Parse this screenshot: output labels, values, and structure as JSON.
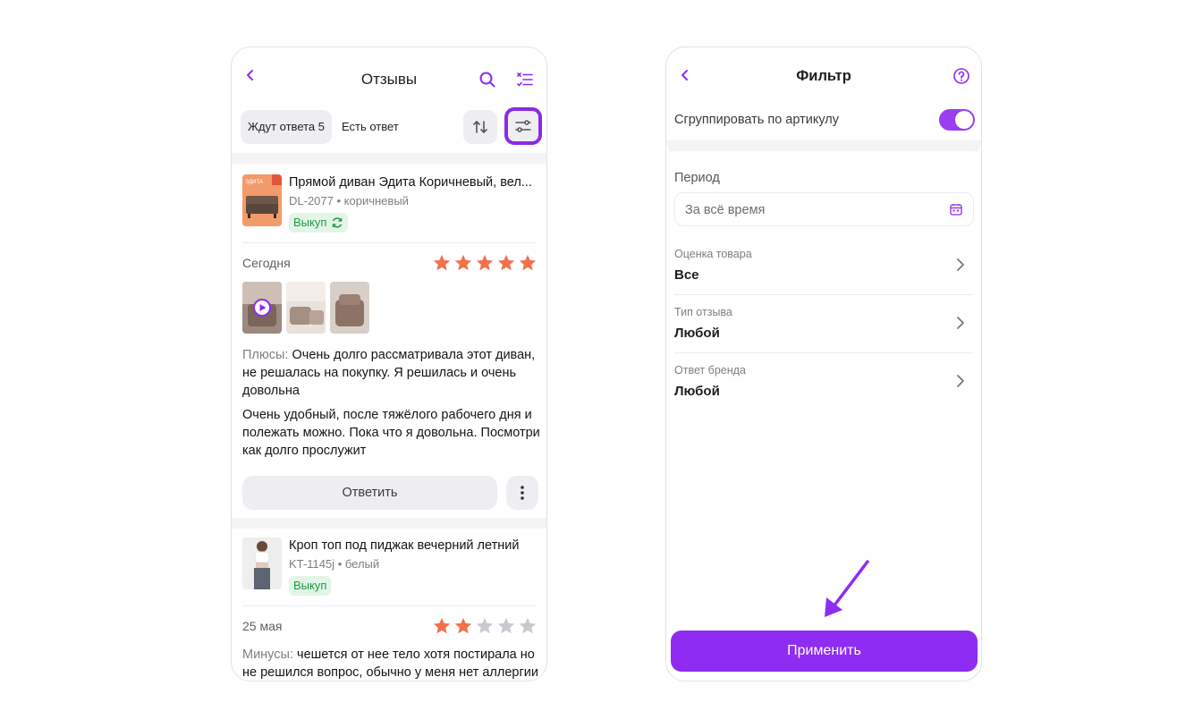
{
  "reviews_screen": {
    "title": "Отзывы",
    "chips": {
      "waiting": "Ждут ответа 5",
      "answered": "Есть ответ"
    },
    "reviews": [
      {
        "product_name": "Прямой диван Эдита Коричневый, вел...",
        "sku": "DL-2077",
        "color": "коричневый",
        "badge": "Выкуп",
        "date": "Сегодня",
        "rating": 5,
        "pros_label": "Плюсы:",
        "pros_text": "Очень долго рассматривала этот диван, не решалась на покупку. Я решилась и очень довольна",
        "comment": "Очень удобный, после тяжёлого рабочего дня и полежать можно. Пока что я довольна. Посмотри как долго прослужит",
        "reply_label": "Ответить",
        "thumb_brand": "ЭДИТА"
      },
      {
        "product_name": "Кроп топ под пиджак вечерний летний",
        "sku": "KT-1145j",
        "color": "белый",
        "badge": "Выкуп",
        "date": "25 мая",
        "rating": 2,
        "cons_label": "Минусы:",
        "cons_text": "чешется от нее тело хотя постирала но не решился вопрос, обычно у меня нет аллергии"
      }
    ]
  },
  "filter_screen": {
    "title": "Фильтр",
    "group_by_label": "Сгруппировать по артикулу",
    "group_by_enabled": true,
    "period_label": "Период",
    "period_value": "За всё время",
    "rows": [
      {
        "label": "Оценка товара",
        "value": "Все"
      },
      {
        "label": "Тип отзыва",
        "value": "Любой"
      },
      {
        "label": "Ответ бренда",
        "value": "Любой"
      }
    ],
    "apply_label": "Применить"
  },
  "colors": {
    "accent": "#8f2cf2",
    "star_filled": "#f2714d",
    "star_empty": "#c9c9cf",
    "badge_green": "#1e9c44"
  },
  "icons": [
    "back-icon",
    "search-icon",
    "checklist-icon",
    "sort-icon",
    "filter-sliders-icon",
    "star-icon",
    "play-icon",
    "refresh-icon",
    "more-vertical-icon",
    "help-icon",
    "calendar-icon",
    "chevron-right-icon",
    "arrow-down-left-icon"
  ]
}
